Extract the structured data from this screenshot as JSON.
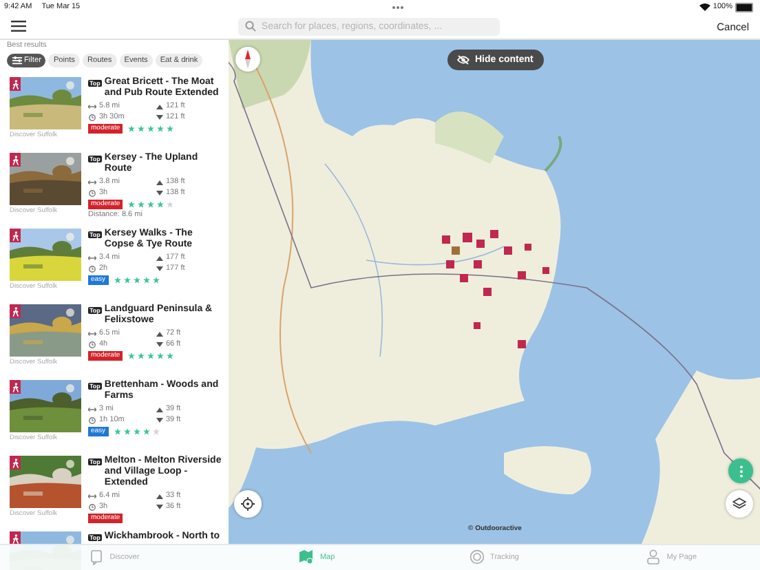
{
  "status_bar": {
    "time": "9:42 AM",
    "date": "Tue Mar 15",
    "battery": "100%"
  },
  "search": {
    "placeholder": "Search for places, regions, coordinates, ..."
  },
  "cancel": "Cancel",
  "section_title": "Best results",
  "filters": [
    {
      "label": "Filter",
      "kind": "filter",
      "selected": true
    },
    {
      "label": "Points",
      "kind": "chip",
      "selected": false
    },
    {
      "label": "Routes",
      "kind": "chip",
      "selected": false
    },
    {
      "label": "Events",
      "kind": "chip",
      "selected": false
    },
    {
      "label": "Eat & drink",
      "kind": "chip",
      "selected": false
    }
  ],
  "routes": [
    {
      "badge": "Top",
      "title": "Great Bricett - The Moat and Pub Route Extended",
      "distance": "5.8 mi",
      "duration": "3h 30m",
      "ascent": "121 ft",
      "descent": "121 ft",
      "difficulty": {
        "label": "moderate",
        "kind": "moderate"
      },
      "stars": 5,
      "source": "Discover Suffolk"
    },
    {
      "badge": "Top",
      "title": "Kersey - The Upland Route",
      "distance": "3.8 mi",
      "duration": "3h",
      "ascent": "138 ft",
      "descent": "138 ft",
      "difficulty": {
        "label": "moderate",
        "kind": "moderate"
      },
      "stars": 4,
      "extra": "Distance: 8.6 mi",
      "source": "Discover Suffolk"
    },
    {
      "badge": "Top",
      "title": "Kersey Walks - The Copse & Tye Route",
      "distance": "3.4 mi",
      "duration": "2h",
      "ascent": "177 ft",
      "descent": "177 ft",
      "difficulty": {
        "label": "easy",
        "kind": "easy"
      },
      "stars": 5,
      "source": "Discover Suffolk"
    },
    {
      "badge": "Top",
      "title": "Landguard Peninsula & Felixstowe",
      "distance": "6.5 mi",
      "duration": "4h",
      "ascent": "72 ft",
      "descent": "66 ft",
      "difficulty": {
        "label": "moderate",
        "kind": "moderate"
      },
      "stars": 5,
      "source": "Discover Suffolk"
    },
    {
      "badge": "Top",
      "title": "Brettenham - Woods and Farms",
      "distance": "3 mi",
      "duration": "1h 10m",
      "ascent": "39 ft",
      "descent": "39 ft",
      "difficulty": {
        "label": "easy",
        "kind": "easy"
      },
      "stars": 4,
      "source": "Discover Suffolk"
    },
    {
      "badge": "Top",
      "title": "Melton - Melton Riverside and Village Loop - Extended",
      "distance": "6.4 mi",
      "duration": "3h",
      "ascent": "33 ft",
      "descent": "36 ft",
      "difficulty": {
        "label": "moderate",
        "kind": "moderate"
      },
      "source": "Discover Suffolk"
    },
    {
      "badge": "Top",
      "title": "Wickhambrook - North to"
    }
  ],
  "map": {
    "hide_button": "Hide content",
    "copyright": "© Outdooractive"
  },
  "tab_bar": [
    {
      "label": "Discover",
      "selected": false
    },
    {
      "label": "Map",
      "selected": true
    },
    {
      "label": "Tracking",
      "selected": false
    },
    {
      "label": "My Page",
      "selected": false
    }
  ]
}
